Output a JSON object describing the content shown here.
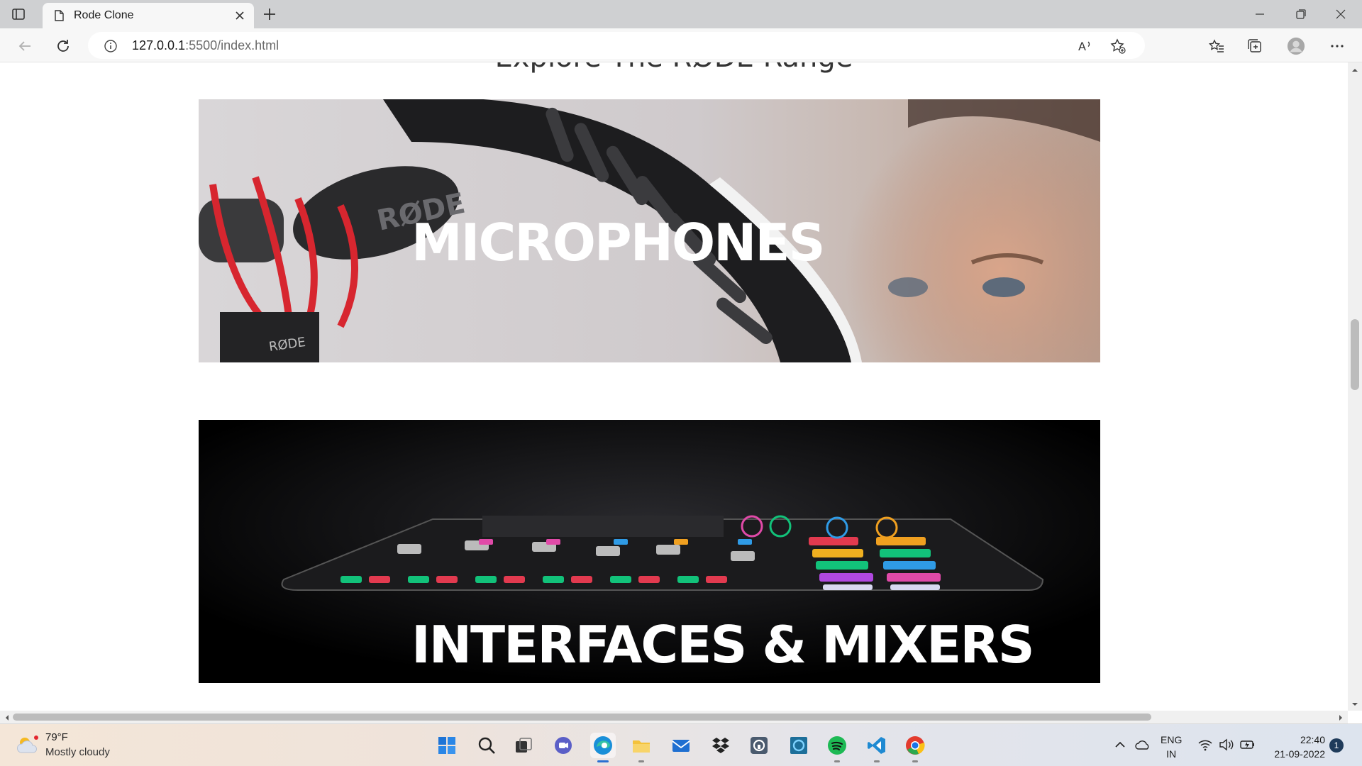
{
  "browser": {
    "tab_title": "Rode Clone",
    "url_host": "127.0.0.1",
    "url_rest": ":5500/index.html"
  },
  "page": {
    "section_title": "Explore The RØDE Range",
    "banners": [
      {
        "label": "MICROPHONES"
      },
      {
        "label": "INTERFACES & MIXERS"
      }
    ]
  },
  "taskbar": {
    "weather_temp": "79°F",
    "weather_desc": "Mostly cloudy",
    "lang_line1": "ENG",
    "lang_line2": "IN",
    "time": "22:40",
    "date": "21-09-2022",
    "notification_count": "1",
    "apps": [
      "start-icon",
      "search-icon",
      "task-view-icon",
      "teams-chat-icon",
      "edge-icon",
      "file-explorer-icon",
      "mail-icon",
      "dropbox-icon",
      "app-icon",
      "cortana-icon",
      "spotify-icon",
      "vscode-icon",
      "chrome-icon"
    ]
  },
  "colors": {
    "tabbar": "#cfd0d2",
    "address_bar": "#f7f7f7",
    "page_bg": "#ffffff",
    "banner_label": "#ffffff"
  }
}
